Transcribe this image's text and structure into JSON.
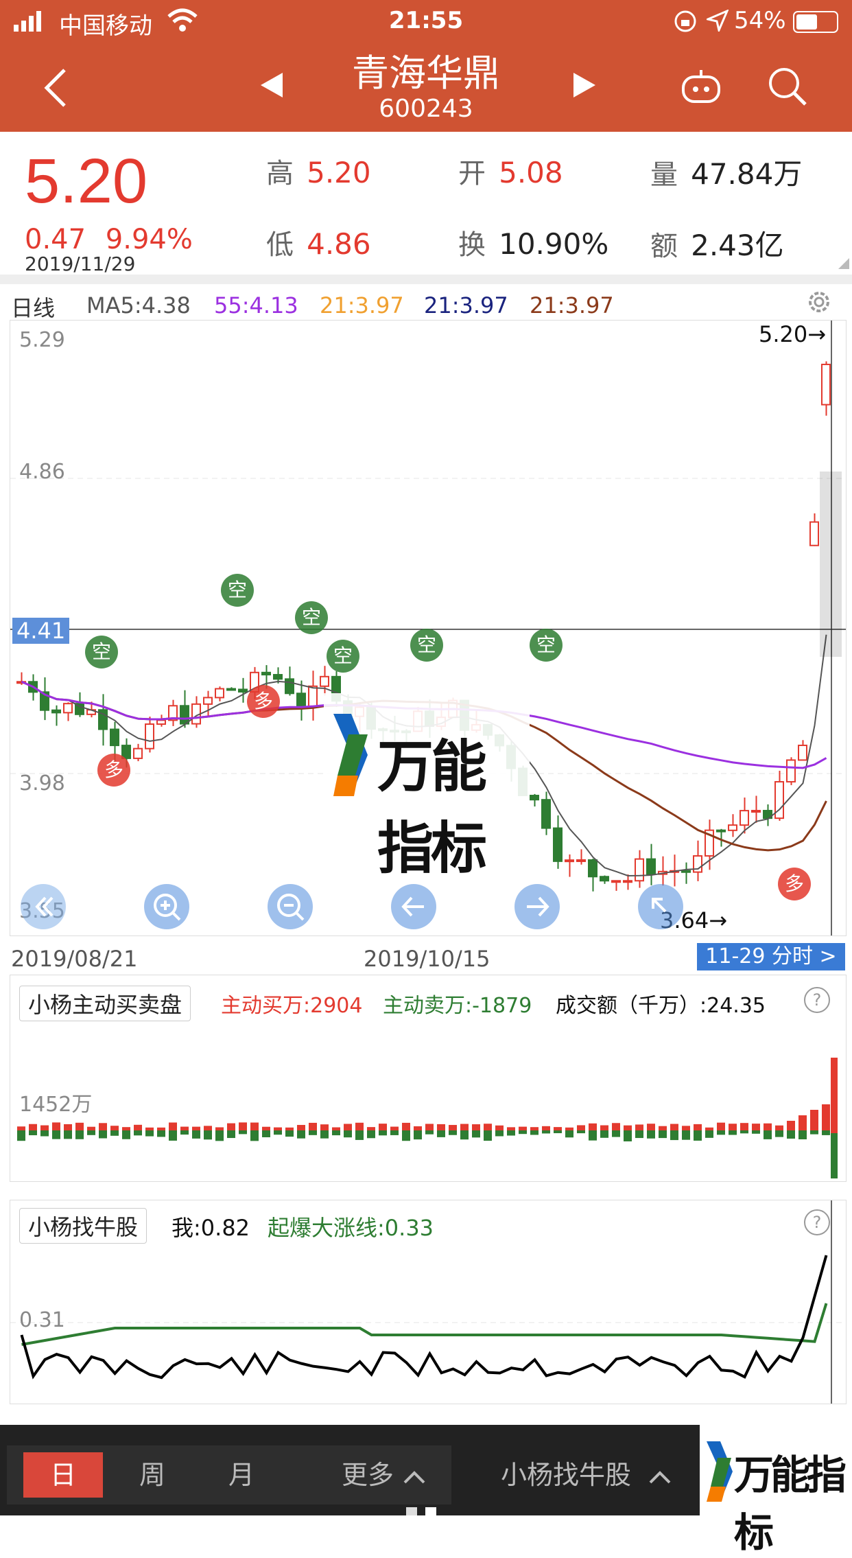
{
  "status": {
    "carrier": "中国移动",
    "time": "21:55",
    "battery": "54%"
  },
  "header": {
    "title": "青海华鼎",
    "code": "600243",
    "icons": [
      "back-icon",
      "prev-triangle-icon",
      "next-triangle-icon",
      "robot-icon",
      "search-icon"
    ]
  },
  "quote": {
    "price": "5.20",
    "change": "0.47",
    "change_pct": "9.94%",
    "date": "2019/11/29",
    "high_label": "高",
    "high": "5.20",
    "open_label": "开",
    "open": "5.08",
    "vol_label": "量",
    "vol": "47.84万",
    "low_label": "低",
    "low": "4.86",
    "turn_label": "换",
    "turn": "10.90%",
    "amt_label": "额",
    "amt": "2.43亿"
  },
  "ma": {
    "period": "日线",
    "ma5": "MA5:4.38",
    "ma55": "55:4.13",
    "ma21a": "21:3.97",
    "ma21b": "21:3.97",
    "ma21c": "21:3.97"
  },
  "colors": {
    "header": "#cf5333",
    "up": "#e33a2f",
    "down": "#2e7d32",
    "purple": "#9b30e0",
    "orange": "#f0a030",
    "navy": "#1a237e",
    "brown": "#8b3a1a"
  },
  "kline": {
    "y_labels": [
      "5.29",
      "4.86",
      "3.98",
      "3.55"
    ],
    "cursor_value": "4.41",
    "high_mark": "5.20→",
    "low_mark": "3.64→",
    "date_left": "2019/08/21",
    "date_mid": "2019/10/15",
    "minute_link": "11-29 分时 >",
    "signal_empty": "空",
    "signal_long": "多",
    "watermark": "万能指标"
  },
  "chart_data": [
    {
      "type": "candlestick",
      "title": "日线",
      "ylim": [
        3.55,
        5.29
      ],
      "x_range": [
        "2019/08/21",
        "2019/11/29"
      ],
      "last_close": 5.2,
      "high_marker": 5.2,
      "low_marker": 3.64
    },
    {
      "type": "bar",
      "title": "小杨主动买卖盘",
      "series": [
        {
          "name": "主动买万",
          "value": 2904
        },
        {
          "name": "主动卖万",
          "value": -1879
        }
      ],
      "y_label": "1452万",
      "turnover": "24.35"
    },
    {
      "type": "line",
      "title": "小杨找牛股",
      "series": [
        {
          "name": "我",
          "value": 0.82
        },
        {
          "name": "起爆大涨线",
          "value": 0.33
        }
      ],
      "y_label": "0.31"
    }
  ],
  "vol_panel": {
    "name": "小杨主动买卖盘",
    "buy": "主动买万:2904",
    "sell": "主动卖万:-1879",
    "turnover": "成交额（千万）:24.35",
    "y_label": "1452万"
  },
  "ind_panel": {
    "name": "小杨找牛股",
    "me": "我:0.82",
    "boom": "起爆大涨线:0.33",
    "y_label": "0.31"
  },
  "footer": {
    "tabs": [
      "日",
      "周",
      "月"
    ],
    "more": "更多",
    "indicator": "小杨找牛股",
    "logo": "万能指标"
  }
}
